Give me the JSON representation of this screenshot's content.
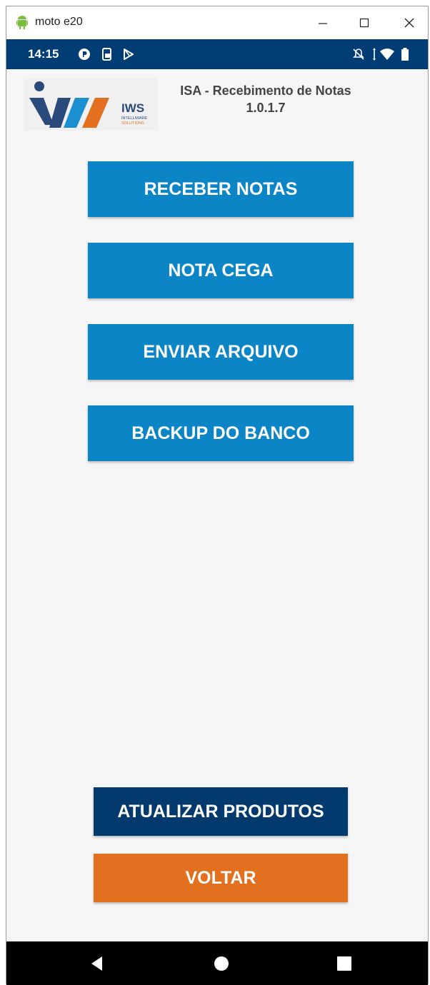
{
  "window": {
    "title": "moto e20",
    "controls": [
      "minimize",
      "maximize",
      "close"
    ]
  },
  "statusbar": {
    "time": "14:15",
    "left_icons": [
      "app-notification-icon",
      "phone-notification-icon",
      "play-store-icon"
    ],
    "right_icons": [
      "mute-icon",
      "data-arrows-icon",
      "wifi-icon",
      "battery-icon"
    ]
  },
  "header": {
    "logo_text": "IWS",
    "logo_subtext_1": "INTELLIWARE",
    "logo_subtext_2": "SOLUTIONS",
    "title": "ISA - Recebimento de Notas",
    "version": "1.0.1.7"
  },
  "menu": {
    "receber_label": "RECEBER NOTAS",
    "nota_cega_label": "NOTA CEGA",
    "enviar_label": "ENVIAR ARQUIVO",
    "backup_label": "BACKUP DO BANCO"
  },
  "footer": {
    "atualizar_label": "ATUALIZAR PRODUTOS",
    "voltar_label": "VOLTAR"
  },
  "navbar": [
    "back",
    "home",
    "recents"
  ],
  "colors": {
    "statusbar": "#003d75",
    "primary_button": "#0b85c6",
    "navy_button": "#033a6e",
    "orange_button": "#e2701f",
    "background": "#f6f6f6"
  }
}
